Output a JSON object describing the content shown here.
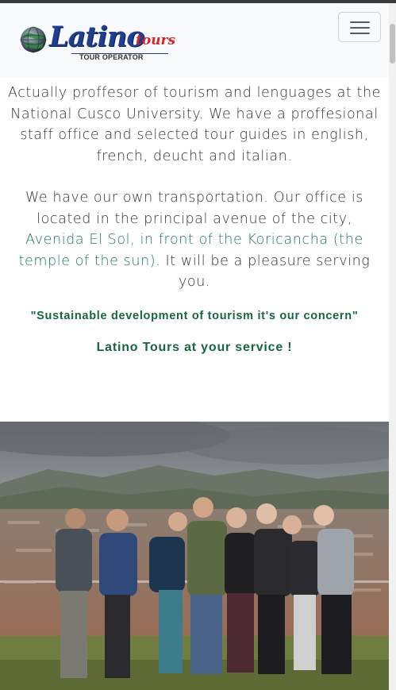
{
  "brand": {
    "name": "Latino",
    "name_suffix": "tours",
    "tagline": "TOUR OPERATOR"
  },
  "nav": {
    "toggler_icon": "hamburger-menu-icon"
  },
  "content": {
    "paragraph1": "Actually proffesor of tourism and lenguages at the National Cusco University. We have a proffesional staff office and selected tour guides in english, french, deucht and italian.",
    "paragraph2_text": "We have our own transportation. Our office is located in the principal avenue of the city, ",
    "paragraph2_link": "Avenida El Sol, in front of the Koricancha (the temple of the sun)",
    "paragraph2_end": ". It will be a pleasure serving you.",
    "quote": "\"Sustainable development of tourism it's our concern\"",
    "service": "Latino Tours at your service !"
  },
  "colors": {
    "brand_blue": "#1f3e8f",
    "brand_red": "#d4252b",
    "accent_green": "#1e7d4f",
    "navbar_bg": "#f8f9fa"
  }
}
